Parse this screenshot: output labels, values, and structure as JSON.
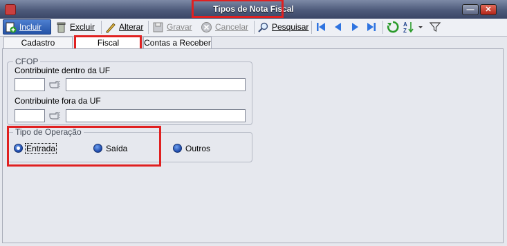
{
  "window": {
    "title": "Tipos de Nota Fiscal"
  },
  "toolbar": {
    "incluir": "Incluir",
    "excluir": "Excluir",
    "alterar": "Alterar",
    "gravar": "Gravar",
    "cancelar": "Cancelar",
    "pesquisar": "Pesquisar"
  },
  "tabs": [
    {
      "label": "Cadastro",
      "active": false
    },
    {
      "label": "Fiscal",
      "active": true
    },
    {
      "label": "Contas a Receber",
      "active": false
    }
  ],
  "cfop": {
    "legend": "CFOP",
    "dentro_label": "Contribuinte dentro da UF",
    "dentro_code": "",
    "dentro_desc": "",
    "fora_label": "Contribuinte fora da UF",
    "fora_code": "",
    "fora_desc": ""
  },
  "operacao": {
    "legend": "Tipo de Operação",
    "options": [
      {
        "label": "Entrada",
        "checked": true
      },
      {
        "label": "Saída",
        "checked": false
      },
      {
        "label": "Outros",
        "checked": false
      }
    ]
  },
  "colors": {
    "highlight": "#e02020",
    "accent": "#2452a6"
  }
}
